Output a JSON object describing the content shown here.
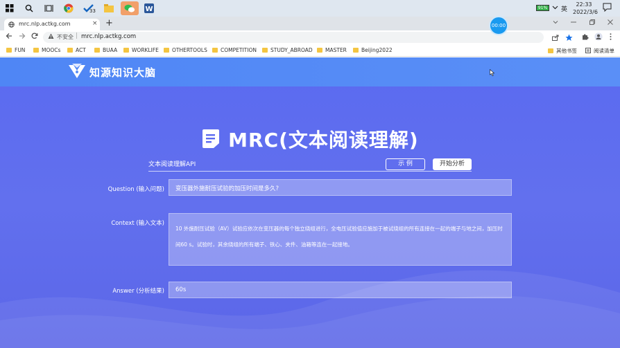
{
  "taskbar": {
    "badge": "33",
    "battery": "91%",
    "ime": "英",
    "time": "22:33",
    "date": "2022/3/6"
  },
  "browser": {
    "tab_title": "mrc.nlp.actkg.com",
    "tab_close": "×",
    "new_tab": "+",
    "recorder": "00:00",
    "insecure_label": "不安全",
    "url": "mrc.nlp.actkg.com",
    "bookmarks": [
      "FUN",
      "MOOCs",
      "ACT",
      "BUAA",
      "WORKLIFE",
      "OTHERTOOLS",
      "COMPETITION",
      "STUDY_ABROAD",
      "MASTER",
      "Beijing2022"
    ],
    "other_bookmarks": "其他书签",
    "reading_list": "阅读清单"
  },
  "site": {
    "logo_text": "知源知识大脑",
    "title": "MRC(文本阅读理解)",
    "api_label": "文本阅读理解API",
    "example_button": "示 例",
    "analyze_button": "开始分析",
    "question_label": "Question (输入问题)",
    "question_value": "变压器外施耐压试验的加压时间是多久?",
    "context_label": "Context (输入文本)",
    "context_value": "10  外施耐压试验（AV）试验应依次在变压器的每个独立绕组进行，全电压试验值应施加于被试绕组的所有连接在一起的端子与地之间，加压时间60 s。试验时，其余绕组的所有端子、铁心、夹件、油箱等连在一起接地。",
    "answer_label": "Answer (分析结果)",
    "answer_value": "60s"
  },
  "colors": {
    "page_bg": "#5a6af0",
    "header_bg": "#4f86f5",
    "recorder": "#1a9af0",
    "folder": "#f4c542"
  }
}
